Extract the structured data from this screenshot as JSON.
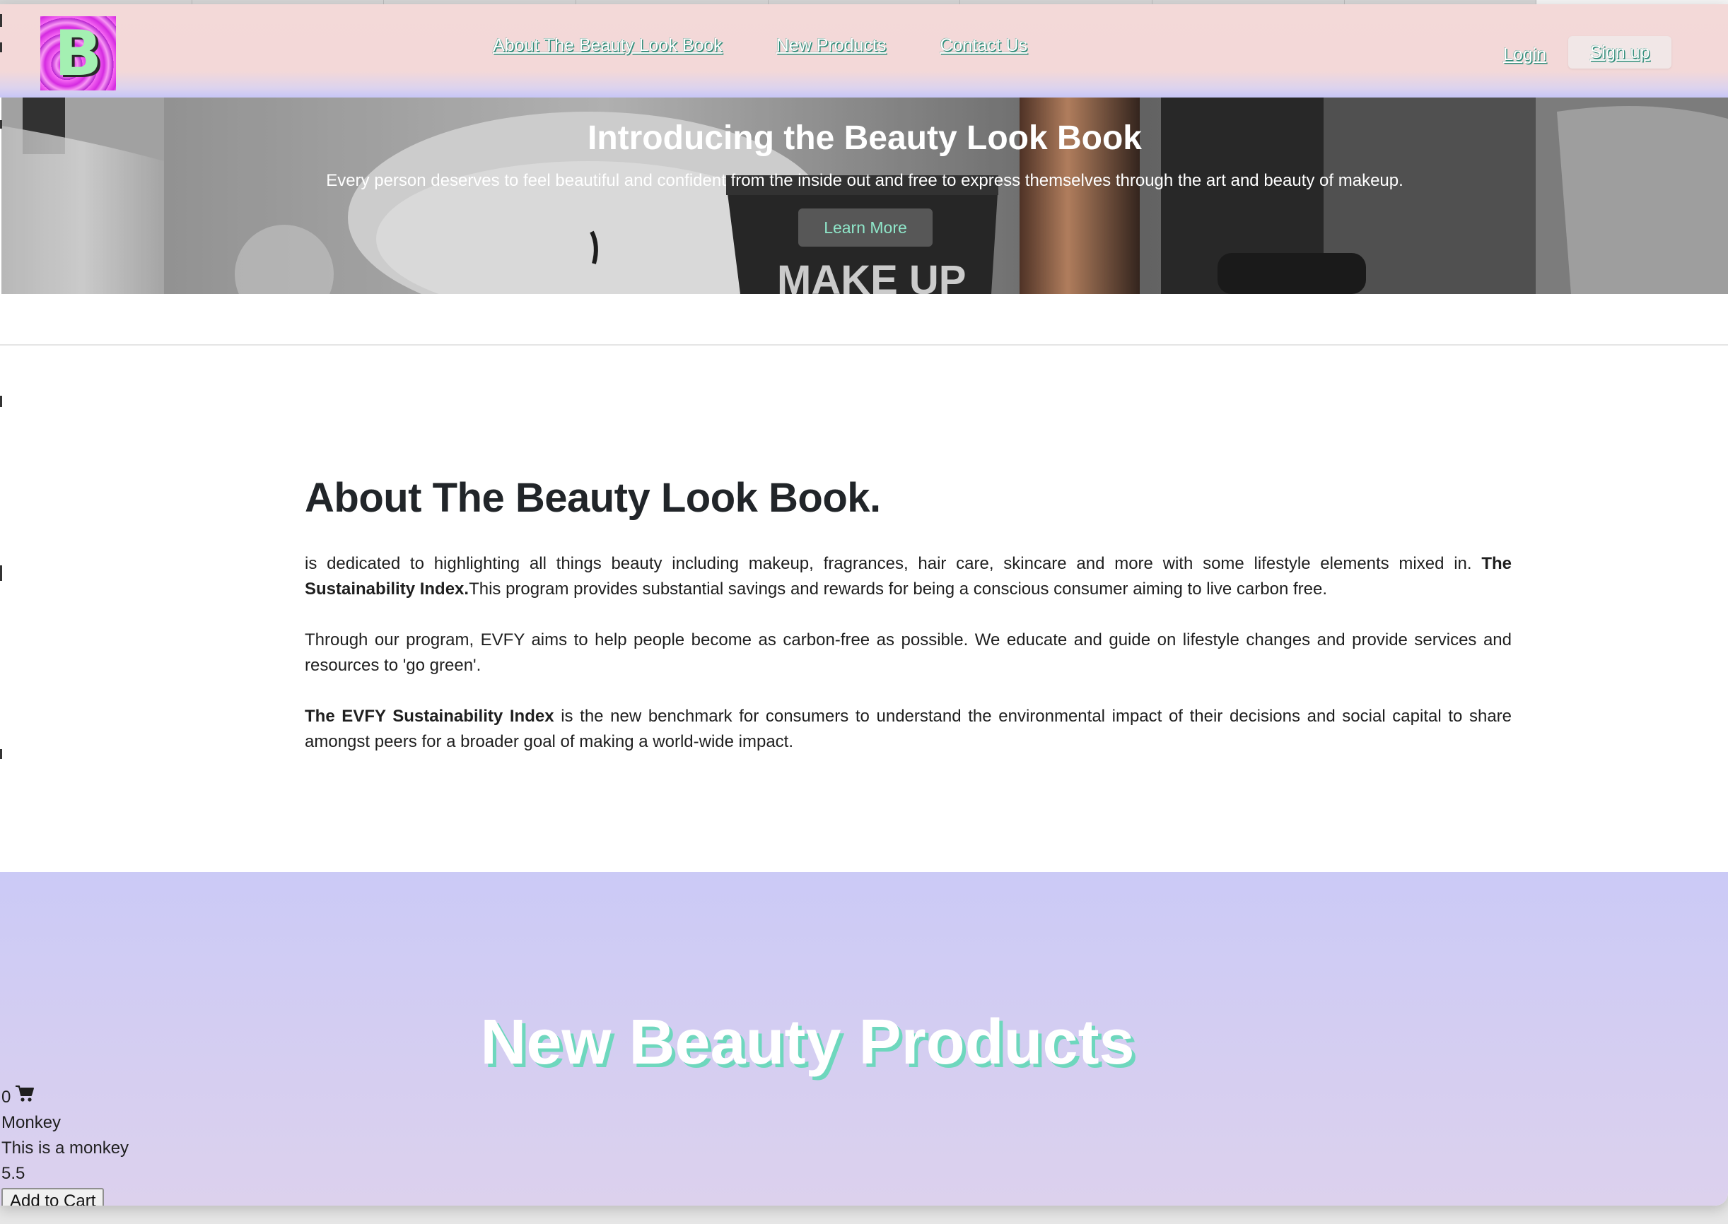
{
  "navbar": {
    "logo_letter": "B",
    "links": [
      "About The Beauty Look Book",
      "New Products",
      "Contact Us"
    ],
    "login_label": "Login",
    "signup_label": "Sign up"
  },
  "hero": {
    "title": "Introducing the Beauty Look Book",
    "subtitle": "Every person deserves to feel beautiful and confident from the inside out and free to express themselves through the art and beauty of makeup.",
    "button_label": "Learn More",
    "image_text": "MAKE UP"
  },
  "about": {
    "heading": "About The Beauty Look Book.",
    "p1_text": "is dedicated to highlighting all things beauty including makeup, fragrances, hair care, skincare and more with some lifestyle elements mixed in. ",
    "p1_bold": "The Sustainability Index.",
    "p1_tail": "This program provides substantial savings and rewards for being a conscious consumer aiming to live carbon free.",
    "p2": "Through our program, EVFY aims to help people become as carbon-free as possible. We educate and guide on lifestyle changes and provide services and resources to 'go green'.",
    "p3_bold": "The EVFY Sustainability Index",
    "p3_tail": " is the new benchmark for consumers to understand the environmental impact of their decisions and social capital to share amongst peers for a broader goal of making a world-wide impact."
  },
  "products": {
    "title": "New Beauty Products",
    "cart_count": "0",
    "item": {
      "name": "Monkey",
      "description": "This is a monkey",
      "price": "5.5",
      "button_label": "Add to Cart"
    }
  },
  "colors": {
    "navbar_pink": "#f3d9d8",
    "products_lavender": "#cbcaf6",
    "text_shadow_teal": "#2f8d7a",
    "logo_magenta": "#e14ae8",
    "logo_letter_green": "#a4f0b2"
  }
}
